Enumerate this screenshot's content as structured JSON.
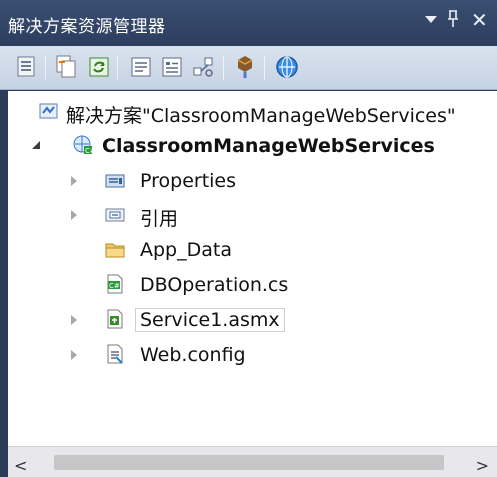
{
  "panel": {
    "title": "解决方案资源管理器",
    "controls": {
      "pin": "ᵖ",
      "close": "✕"
    }
  },
  "toolbar": {
    "buttons": [
      "properties-icon",
      "show-all-files-icon",
      "refresh-icon",
      "view-code-icon",
      "view-designer-icon",
      "class-diagram-icon",
      "copy-website-icon",
      "asp-net-config-icon"
    ]
  },
  "tree": {
    "solution_label": "解决方案\"ClassroomManageWebServices\"",
    "project_label": "ClassroomManageWebServices",
    "items": [
      {
        "label": "Properties",
        "icon": "properties-folder-icon",
        "expandable": true
      },
      {
        "label": "引用",
        "icon": "references-icon",
        "expandable": true
      },
      {
        "label": "App_Data",
        "icon": "folder-icon",
        "expandable": false
      },
      {
        "label": "DBOperation.cs",
        "icon": "csharp-file-icon",
        "expandable": false
      },
      {
        "label": "Service1.asmx",
        "icon": "asmx-file-icon",
        "expandable": true
      },
      {
        "label": "Web.config",
        "icon": "config-file-icon",
        "expandable": true
      }
    ]
  },
  "scrollbar": {
    "left": "<",
    "right": ">"
  },
  "colors": {
    "titlebar": "#2c3e5f",
    "toolbar": "#cfdae8",
    "background": "#ffffff"
  }
}
